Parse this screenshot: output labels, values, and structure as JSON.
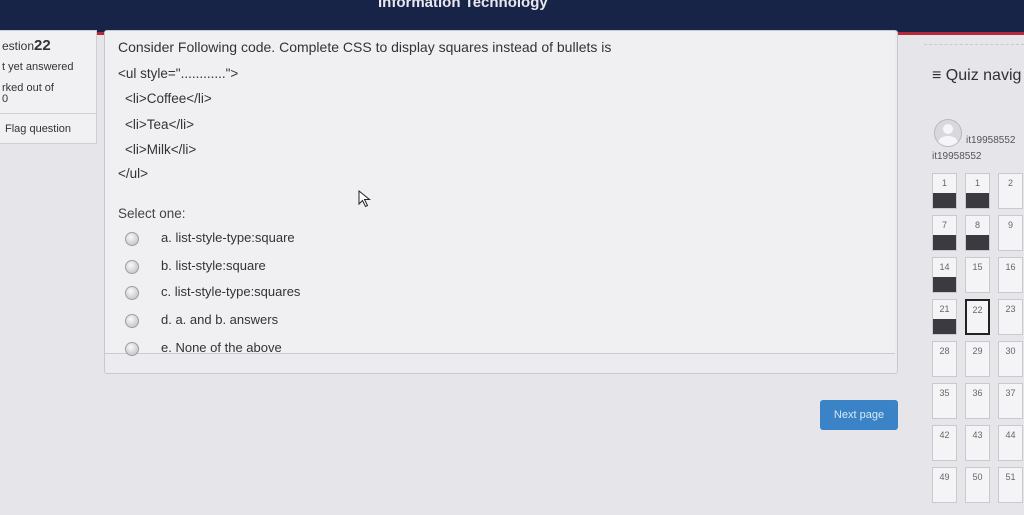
{
  "header": {
    "banner_text": "Information Technology"
  },
  "question_info": {
    "number_prefix": "estion",
    "number": "22",
    "status": "t yet answered",
    "marked_label": "rked out of",
    "marked_value": "0",
    "flag_label": "Flag question"
  },
  "question": {
    "prompt": "Consider Following code. Complete CSS to display squares instead of bullets is",
    "code_lines": [
      "<ul style=\"............\">",
      "<li>Coffee</li>",
      "<li>Tea</li>",
      "<li>Milk</li>",
      "</ul>"
    ],
    "select_label": "Select one:",
    "options": [
      "a. list-style-type:square",
      "b. list-style:square",
      "c. list-style-type:squares",
      "d. a. and b. answers",
      "e. None of the above"
    ]
  },
  "next_button": "Next page",
  "quiz_nav": {
    "title": "Quiz navig",
    "user_short": "it19958552",
    "user_full": "it19958552",
    "question_numbers": [
      "1",
      "1",
      "2",
      "7",
      "8",
      "9",
      "14",
      "15",
      "16",
      "21",
      "22",
      "23",
      "28",
      "29",
      "30",
      "35",
      "36",
      "37",
      "42",
      "43",
      "44",
      "49",
      "50",
      "51"
    ],
    "answered": [
      true,
      true,
      false,
      true,
      true,
      false,
      true,
      false,
      false,
      true,
      false,
      false,
      false,
      false,
      false,
      false,
      false,
      false,
      false,
      false,
      false,
      false,
      false,
      false
    ],
    "current": "22"
  }
}
